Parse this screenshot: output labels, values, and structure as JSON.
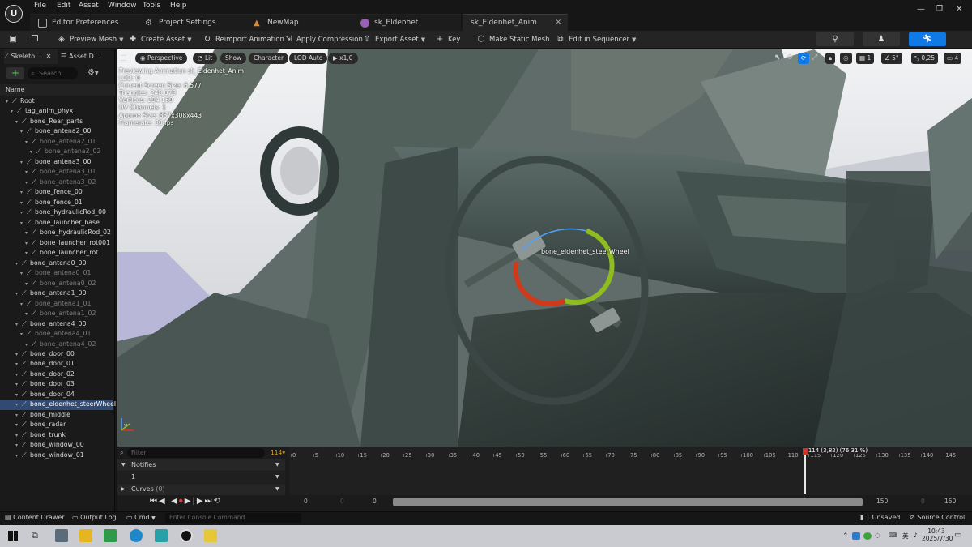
{
  "menu": [
    "File",
    "Edit",
    "Asset",
    "Window",
    "Tools",
    "Help"
  ],
  "tabs": [
    {
      "label": "Editor Preferences"
    },
    {
      "label": "Project Settings"
    },
    {
      "label": "NewMap"
    },
    {
      "label": "sk_Eldenhet"
    },
    {
      "label": "sk_Eldenhet_Anim"
    }
  ],
  "toolbar": {
    "preview_mesh": "Preview Mesh",
    "create_asset": "Create Asset",
    "reimport": "Reimport Animation",
    "apply_compression": "Apply Compression",
    "export_asset": "Export Asset",
    "key": "Key",
    "make_static_mesh": "Make Static Mesh",
    "edit_sequencer": "Edit in Sequencer"
  },
  "left": {
    "tab1": "Skeleto...",
    "tab2": "Asset D...",
    "search_placeholder": "Search",
    "name_header": "Name",
    "bones": [
      {
        "label": "Root",
        "level": 0,
        "dim": false
      },
      {
        "label": "tag_anim_phyx",
        "level": 1,
        "dim": false
      },
      {
        "label": "bone_Rear_parts",
        "level": 2,
        "dim": false
      },
      {
        "label": "bone_antena2_00",
        "level": 3,
        "dim": false
      },
      {
        "label": "bone_antena2_01",
        "level": 4,
        "dim": true
      },
      {
        "label": "bone_antena2_02",
        "level": 5,
        "dim": true
      },
      {
        "label": "bone_antena3_00",
        "level": 3,
        "dim": false
      },
      {
        "label": "bone_antena3_01",
        "level": 4,
        "dim": true
      },
      {
        "label": "bone_antena3_02",
        "level": 4,
        "dim": true
      },
      {
        "label": "bone_fence_00",
        "level": 3,
        "dim": false
      },
      {
        "label": "bone_fence_01",
        "level": 3,
        "dim": false
      },
      {
        "label": "bone_hydraulicRod_00",
        "level": 3,
        "dim": false
      },
      {
        "label": "bone_launcher_base",
        "level": 3,
        "dim": false
      },
      {
        "label": "bone_hydraulicRod_02",
        "level": 4,
        "dim": false
      },
      {
        "label": "bone_launcher_rot001",
        "level": 4,
        "dim": false
      },
      {
        "label": "bone_launcher_rot",
        "level": 4,
        "dim": false
      },
      {
        "label": "bone_antena0_00",
        "level": 2,
        "dim": false
      },
      {
        "label": "bone_antena0_01",
        "level": 3,
        "dim": true
      },
      {
        "label": "bone_antena0_02",
        "level": 4,
        "dim": true
      },
      {
        "label": "bone_antena1_00",
        "level": 2,
        "dim": false
      },
      {
        "label": "bone_antena1_01",
        "level": 3,
        "dim": true
      },
      {
        "label": "bone_antena1_02",
        "level": 4,
        "dim": true
      },
      {
        "label": "bone_antena4_00",
        "level": 2,
        "dim": false
      },
      {
        "label": "bone_antena4_01",
        "level": 3,
        "dim": true
      },
      {
        "label": "bone_antena4_02",
        "level": 4,
        "dim": true
      },
      {
        "label": "bone_door_00",
        "level": 2,
        "dim": false
      },
      {
        "label": "bone_door_01",
        "level": 2,
        "dim": false
      },
      {
        "label": "bone_door_02",
        "level": 2,
        "dim": false
      },
      {
        "label": "bone_door_03",
        "level": 2,
        "dim": false
      },
      {
        "label": "bone_door_04",
        "level": 2,
        "dim": false
      },
      {
        "label": "bone_eldenhet_steerWheel",
        "level": 2,
        "dim": false,
        "selected": true
      },
      {
        "label": "bone_middle",
        "level": 2,
        "dim": false
      },
      {
        "label": "bone_radar",
        "level": 2,
        "dim": false
      },
      {
        "label": "bone_trunk",
        "level": 2,
        "dim": false
      },
      {
        "label": "bone_window_00",
        "level": 2,
        "dim": false
      },
      {
        "label": "bone_window_01",
        "level": 2,
        "dim": false
      }
    ]
  },
  "viewport": {
    "perspective": "Perspective",
    "lit": "Lit",
    "show": "Show",
    "character": "Character",
    "lod": "LOD Auto",
    "speed": "x1,0",
    "grid": "1",
    "angle": "5°",
    "scale": "0,25",
    "cam": "4",
    "info": [
      "Previewing Animation sk_Eldenhet_Anim",
      "LOD: 0",
      "Current Screen Size: 6,577",
      "Triangles: 248 079",
      "Vertices: 294 169",
      "UV Channels: 1",
      "Approx Size: 857x308x443",
      "Framerate: 30 fps"
    ],
    "bone_label": "bone_eldenhet_steerWheel"
  },
  "timeline": {
    "filter_placeholder": "Filter",
    "frame_count": "114",
    "notifies": "Notifies",
    "track_index": "1",
    "curves": "Curves",
    "curves_count": "(0)",
    "ticks": [
      "0",
      "5",
      "10",
      "15",
      "20",
      "25",
      "30",
      "35",
      "40",
      "45",
      "50",
      "55",
      "60",
      "65",
      "70",
      "75",
      "80",
      "85",
      "90",
      "95",
      "100",
      "105",
      "110",
      "115",
      "120",
      "125",
      "130",
      "135",
      "140",
      "145"
    ],
    "playhead": "114 (3,82) (76,31 %)",
    "range_start": "0",
    "range_mid": "0",
    "range_zero": "0",
    "range_end": "150",
    "range_end2": "150",
    "play_progress": 0.763
  },
  "status": {
    "content_drawer": "Content Drawer",
    "output_log": "Output Log",
    "cmd": "Cmd",
    "console_placeholder": "Enter Console Command",
    "unsaved": "1 Unsaved",
    "source_control": "Source Control"
  },
  "taskbar": {
    "ime": "英",
    "time": "10:43",
    "date": "2025/7/30"
  }
}
